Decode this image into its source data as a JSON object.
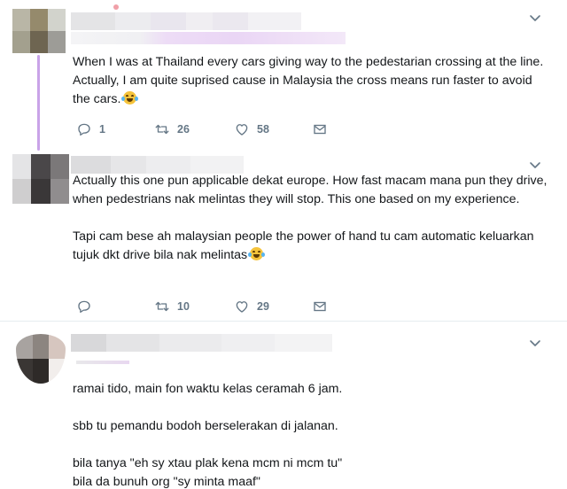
{
  "tweets": [
    {
      "text": "When I was at Thailand every cars giving way to the pedestarian crossing at the line. Actually, I am quite suprised cause in Malaysia the cross means run faster to avoid the cars.",
      "has_emoji": true,
      "replies": "1",
      "retweets": "26",
      "likes": "58"
    },
    {
      "text": "Actually this one pun applicable dekat europe. How fast macam mana pun they drive, when pedestrians nak melintas they will stop. This one based on my experience.\n\nTapi cam bese ah malaysian people the power of hand tu cam automatic keluarkan tujuk dkt drive bila nak melintas",
      "has_emoji": true,
      "replies": "",
      "retweets": "10",
      "likes": "29"
    },
    {
      "text": "ramai tido, main fon waktu kelas ceramah 6 jam.\n\nsbb tu pemandu bodoh berselerakan di jalanan.\n\nbila tanya \"eh sy xtau plak kena mcm ni mcm tu\"\nbila da bunuh org \"sy minta maaf\"",
      "has_emoji": false
    }
  ],
  "icons": {
    "reply": "reply-icon",
    "retweet": "retweet-icon",
    "like": "heart-icon",
    "dm": "envelope-icon",
    "more": "chevron-down-icon"
  },
  "colors": {
    "icon_gray": "#657786",
    "divider": "#e6ecf0",
    "thread_line": "#c9a3e8"
  }
}
